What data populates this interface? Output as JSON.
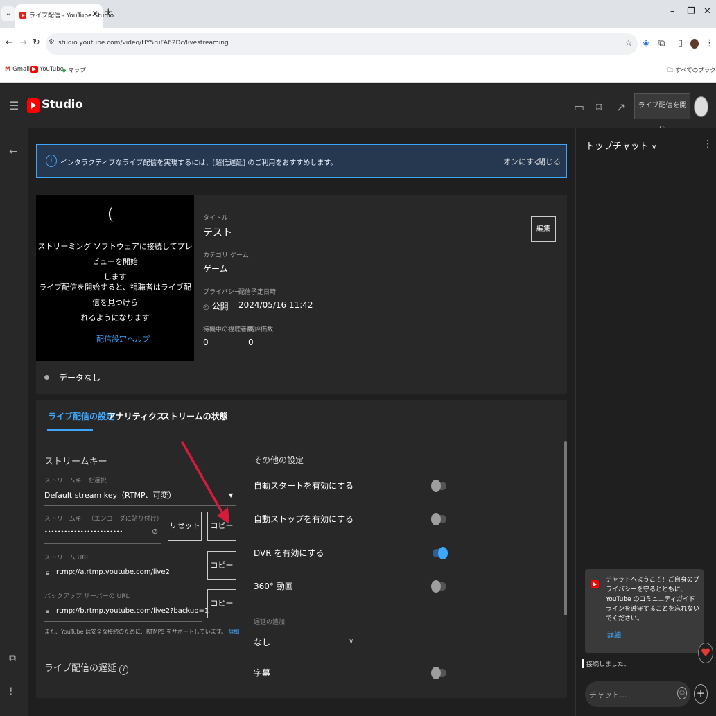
{
  "browser": {
    "tab_title": "ライブ配信 - YouTube Studio",
    "url": "studio.youtube.com/video/HY5ruFA62Dc/livestreaming",
    "bookmarks": [
      "Gmail",
      "YouTube",
      "マップ"
    ],
    "all_bookmarks": "すべてのブックマーク"
  },
  "header": {
    "logo_text": "Studio",
    "go_live_label": "ライブ配信を開始"
  },
  "banner": {
    "text": "インタラクティブなライブ配信を実現するには、[超低遅延] のご利用をおすすめします。",
    "turn_on": "オンにする",
    "close": "閉じる"
  },
  "preview": {
    "line1": "ストリーミング ソフトウェアに接続してプレビューを開始",
    "line2": "します",
    "line3": "ライブ配信を開始すると、視聴者はライブ配信を見つけら",
    "line4": "れるようになります",
    "help_link": "配信設定ヘルプ"
  },
  "details": {
    "title_label": "タイトル",
    "title": "テスト",
    "category_label": "カテゴリ",
    "category": "ゲーム",
    "game_label": "ゲーム",
    "game": "-",
    "privacy_label": "プライバシー",
    "privacy": "公開",
    "scheduled_label": "配信予定日時",
    "scheduled": "2024/05/16 11:42",
    "waiting_label": "待機中の視聴者数",
    "waiting": "0",
    "likes_label": "高評価数",
    "likes": "0",
    "edit_label": "編集"
  },
  "status": {
    "health": "データなし"
  },
  "tabs": [
    "ライブ配信の設定",
    "アナリティクス",
    "ストリームの状態"
  ],
  "stream_key": {
    "section_title": "ストリームキー",
    "select_label": "ストリームキーを選択",
    "select_value": "Default stream key（RTMP、可変）",
    "key_label": "ストリームキー（エンコーダに貼り付け）",
    "key_value": "••••••••••••••••••••••••",
    "reset_label": "リセット",
    "copy_label": "コピー",
    "url_label": "ストリーム URL",
    "url_value": "rtmp://a.rtmp.youtube.com/live2",
    "backup_label": "バックアップ サーバーの URL",
    "backup_value": "rtmp://b.rtmp.youtube.com/live2?backup=1",
    "note": "また、YouTube は安全な接続のために、RTMPS をサポートしています。",
    "note_link": "詳細",
    "latency_title": "ライブ配信の遅延"
  },
  "other_settings": {
    "section_title": "その他の設定",
    "auto_start": "自動スタートを有効にする",
    "auto_stop": "自動ストップを有効にする",
    "dvr": "DVR を有効にする",
    "video360": "360° 動画",
    "delay_label": "遅延の追加",
    "delay_value": "なし",
    "captions": "字幕",
    "toggles": {
      "auto_start": false,
      "auto_stop": false,
      "dvr": true,
      "video360": false,
      "captions": false
    }
  },
  "chat": {
    "title": "トップチャット",
    "welcome": "チャットへようこそ！ご自身のプライバシーを守るとともに、YouTube のコミュニティガイドラインを遵守することを忘れないでください。",
    "details_link": "詳細",
    "connected": "接続しました。",
    "input_placeholder": "チャット..."
  },
  "colors": {
    "accent": "#3ea6ff",
    "brand_red": "#ff0000",
    "annotation_arrow": "#d81b3c"
  }
}
